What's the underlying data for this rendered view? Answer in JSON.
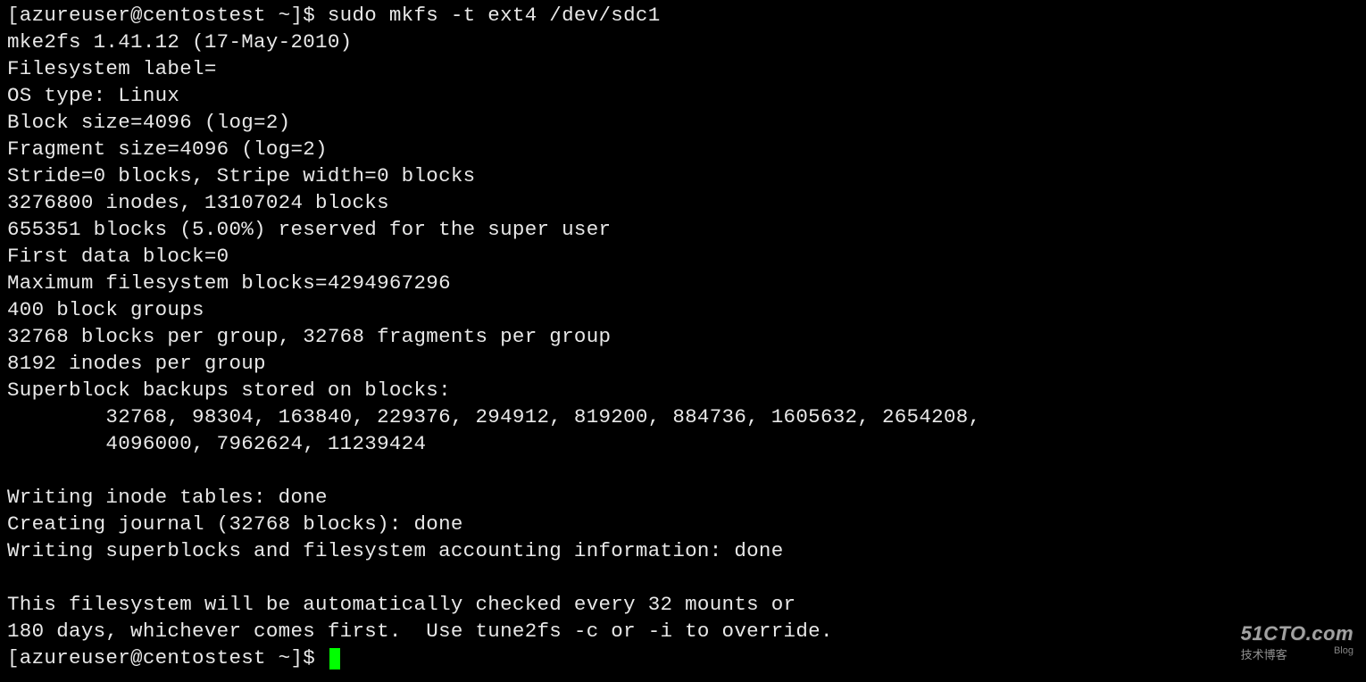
{
  "terminal": {
    "prompt1": "[azureuser@centostest ~]$ ",
    "command1": "sudo mkfs -t ext4 /dev/sdc1",
    "lines": [
      "mke2fs 1.41.12 (17-May-2010)",
      "Filesystem label=",
      "OS type: Linux",
      "Block size=4096 (log=2)",
      "Fragment size=4096 (log=2)",
      "Stride=0 blocks, Stripe width=0 blocks",
      "3276800 inodes, 13107024 blocks",
      "655351 blocks (5.00%) reserved for the super user",
      "First data block=0",
      "Maximum filesystem blocks=4294967296",
      "400 block groups",
      "32768 blocks per group, 32768 fragments per group",
      "8192 inodes per group",
      "Superblock backups stored on blocks: ",
      "        32768, 98304, 163840, 229376, 294912, 819200, 884736, 1605632, 2654208, ",
      "        4096000, 7962624, 11239424",
      "",
      "Writing inode tables: done",
      "Creating journal (32768 blocks): done",
      "Writing superblocks and filesystem accounting information: done",
      "",
      "This filesystem will be automatically checked every 32 mounts or",
      "180 days, whichever comes first.  Use tune2fs -c or -i to override."
    ],
    "prompt2": "[azureuser@centostest ~]$ "
  },
  "watermark": {
    "top": "51CTO.com",
    "bottom_left": "技术博客",
    "bottom_right": "Blog"
  }
}
